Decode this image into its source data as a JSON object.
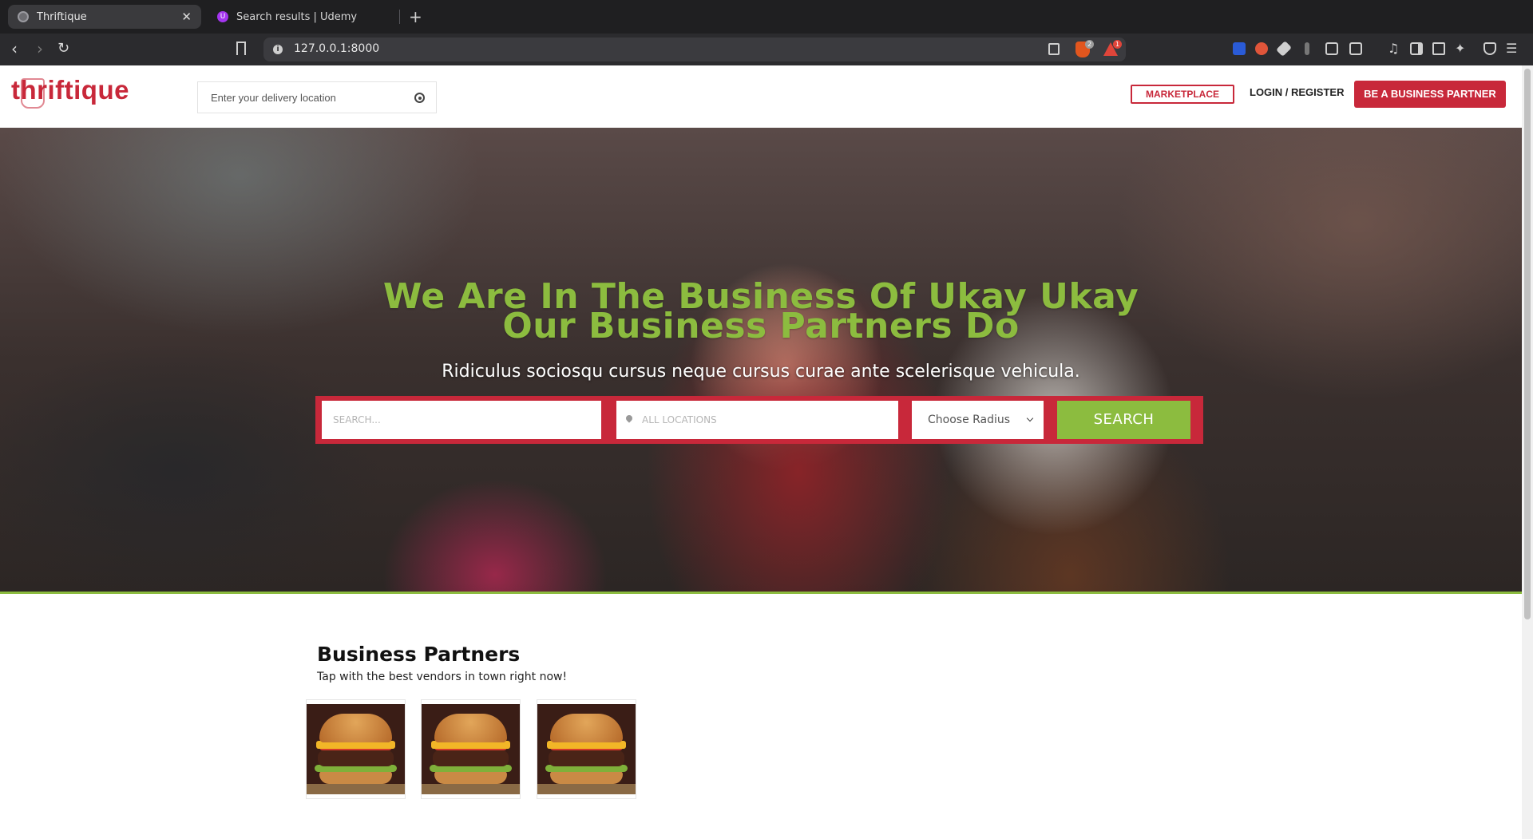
{
  "browser": {
    "tabs": [
      {
        "title": "Thriftique",
        "active": true
      },
      {
        "title": "Search results | Udemy",
        "active": false
      }
    ],
    "url": "127.0.0.1:8000",
    "badges": {
      "brave_shields": "2",
      "alerts": "1"
    }
  },
  "header": {
    "logo": "thriftique",
    "delivery_placeholder": "Enter your delivery location",
    "marketplace_label": "MARKETPLACE",
    "login_label": "LOGIN / REGISTER",
    "partner_button_label": "BE A BUSINESS PARTNER"
  },
  "hero": {
    "title_line1": "We Are In The Business Of Ukay Ukay",
    "title_line2": "Our Business Partners Do",
    "subtitle": "Ridiculus sociosqu cursus neque cursus curae ante scelerisque vehicula.",
    "search_placeholder": "SEARCH...",
    "location_placeholder": "ALL LOCATIONS",
    "radius_selected": "Choose Radius",
    "search_button": "SEARCH"
  },
  "partners": {
    "title": "Business Partners",
    "subtitle": "Tap with the best vendors in town right now!",
    "cards": [
      {
        "image": "burger-image"
      },
      {
        "image": "burger-image"
      },
      {
        "image": "burger-image"
      }
    ]
  },
  "colors": {
    "brand_red": "#c8283a",
    "accent_green": "#8cbc3f",
    "chrome_dark": "#1f1f21"
  }
}
